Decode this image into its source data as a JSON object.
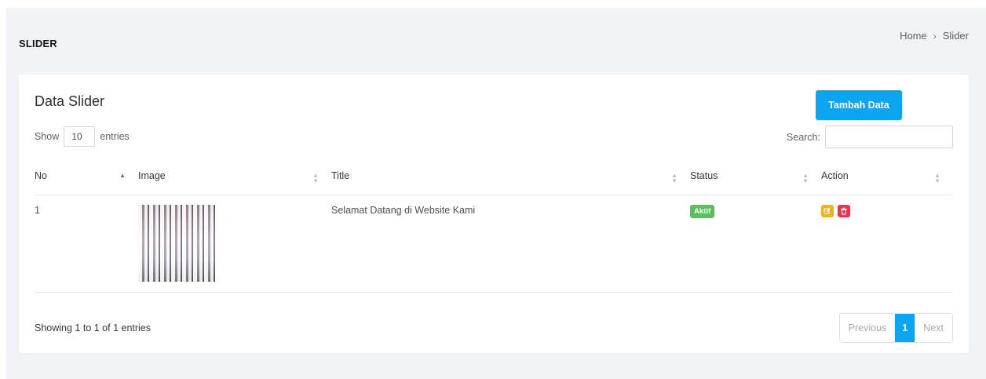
{
  "header": {
    "title": "SLIDER"
  },
  "breadcrumb": {
    "home": "Home",
    "separator": "›",
    "current": "Slider"
  },
  "card": {
    "title": "Data Slider",
    "add_button": "Tambah Data",
    "length": {
      "show": "Show",
      "value": "10",
      "entries": "entries"
    },
    "search": {
      "label": "Search:",
      "value": ""
    }
  },
  "table": {
    "columns": [
      "No",
      "Image",
      "Title",
      "Status",
      "Action"
    ],
    "rows": [
      {
        "no": "1",
        "image": "slider-photo",
        "title": "Selamat Datang di Website Kami",
        "status": "Aktif"
      }
    ],
    "actions": {
      "edit_icon": "edit-icon",
      "delete_icon": "trash-icon"
    }
  },
  "footer": {
    "info": "Showing 1 to 1 of 1 entries",
    "pagination": {
      "previous": "Previous",
      "current": "1",
      "next": "Next"
    }
  },
  "colors": {
    "primary": "#0ea5f0",
    "success": "#58c15e",
    "warning": "#f4ae22",
    "danger": "#ea3351",
    "background": "#f1f3f6"
  }
}
